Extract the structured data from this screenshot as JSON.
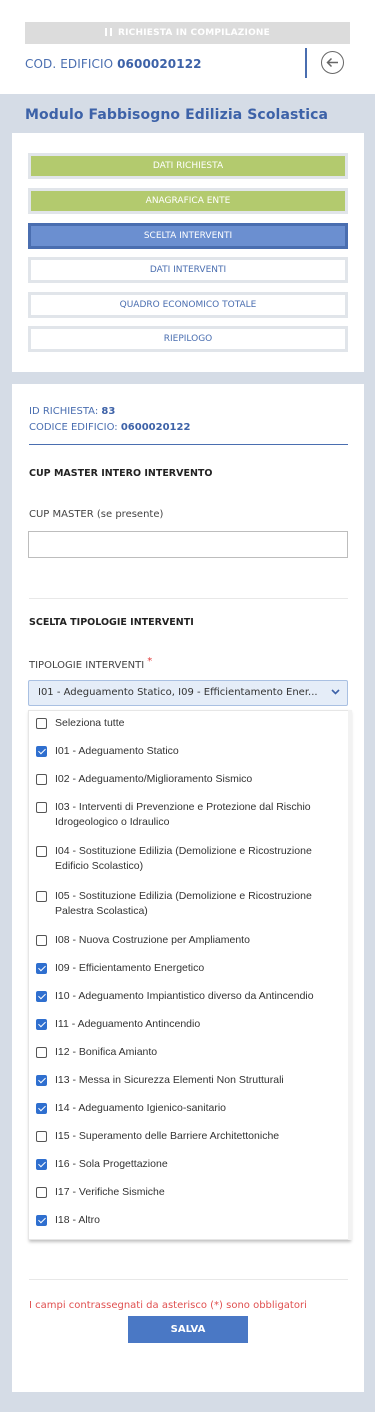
{
  "header": {
    "status_text": "RICHIESTA IN COMPILAZIONE",
    "cod_label": "COD. EDIFICIO",
    "cod_value": "0600020122"
  },
  "module_title": "Modulo Fabbisogno Edilizia Scolastica",
  "steps": [
    {
      "label": "DATI RICHIESTA",
      "state": "done"
    },
    {
      "label": "ANAGRAFICA ENTE",
      "state": "done"
    },
    {
      "label": "SCELTA INTERVENTI",
      "state": "active"
    },
    {
      "label": "DATI INTERVENTI",
      "state": "todo"
    },
    {
      "label": "QUADRO ECONOMICO TOTALE",
      "state": "todo"
    },
    {
      "label": "RIEPILOGO",
      "state": "todo"
    }
  ],
  "info": {
    "id_label": "ID RICHIESTA:",
    "id_value": "83",
    "codice_label": "CODICE EDIFICIO:",
    "codice_value": "0600020122"
  },
  "cup": {
    "section_title": "CUP MASTER INTERO INTERVENTO",
    "field_label": "CUP MASTER (se presente)",
    "value": ""
  },
  "tipologie": {
    "section_title": "SCELTA TIPOLOGIE INTERVENTI",
    "field_label": "TIPOLOGIE INTERVENTI",
    "required_mark": "*",
    "selected_text": "I01 - Adeguamento Statico, I09 - Efficientamento Ener...",
    "options": [
      {
        "label": "Seleziona tutte",
        "checked": false
      },
      {
        "label": "I01 - Adeguamento Statico",
        "checked": true
      },
      {
        "label": "I02 - Adeguamento/Miglioramento Sismico",
        "checked": false
      },
      {
        "label": "I03 - Interventi di Prevenzione e Protezione dal Rischio Idrogeologico o Idraulico",
        "checked": false
      },
      {
        "label": "I04 - Sostituzione Edilizia (Demolizione e Ricostruzione Edificio Scolastico)",
        "checked": false
      },
      {
        "label": "I05 - Sostituzione Edilizia (Demolizione e Ricostruzione Palestra Scolastica)",
        "checked": false
      },
      {
        "label": "I08 - Nuova Costruzione per Ampliamento",
        "checked": false
      },
      {
        "label": "I09 - Efficientamento Energetico",
        "checked": true
      },
      {
        "label": "I10 - Adeguamento Impiantistico diverso da Antincendio",
        "checked": true
      },
      {
        "label": "I11 - Adeguamento Antincendio",
        "checked": true
      },
      {
        "label": "I12 - Bonifica Amianto",
        "checked": false
      },
      {
        "label": "I13 - Messa in Sicurezza Elementi Non Strutturali",
        "checked": true
      },
      {
        "label": "I14 - Adeguamento Igienico-sanitario",
        "checked": true
      },
      {
        "label": "I15 - Superamento delle Barriere Architettoniche",
        "checked": false
      },
      {
        "label": "I16 - Sola Progettazione",
        "checked": true
      },
      {
        "label": "I17 - Verifiche Sismiche",
        "checked": false
      },
      {
        "label": "I18 - Altro",
        "checked": true
      }
    ]
  },
  "footer": {
    "required_note": "I campi contrassegnati da asterisco (*) sono obbligatori",
    "save_label": "SALVA"
  }
}
